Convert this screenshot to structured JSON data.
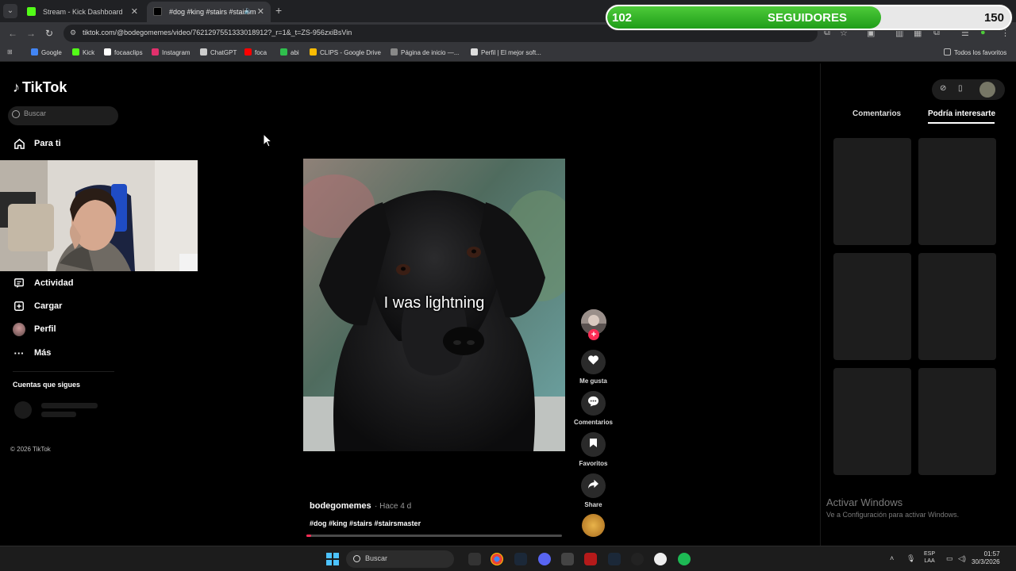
{
  "browser": {
    "tabs": [
      {
        "title": "Stream - Kick Dashboard",
        "favicon_color": "#53fc18"
      },
      {
        "title": "#dog #king #stairs #stairsm",
        "favicon_color": "#ffffff"
      }
    ],
    "url": "tiktok.com/@bodegomemes/video/7621297551333018912?_r=1&_t=ZS-956zxiBsVin",
    "bookmarks": [
      {
        "label": "Google",
        "icon": "google-icon",
        "color": "#4285f4"
      },
      {
        "label": "Kick",
        "icon": "kick-icon",
        "color": "#53fc18"
      },
      {
        "label": "focaaclips",
        "icon": "tiktok-icon",
        "color": "#ffffff"
      },
      {
        "label": "Instagram",
        "icon": "instagram-icon",
        "color": "#e1306c"
      },
      {
        "label": "ChatGPT",
        "icon": "chatgpt-icon",
        "color": "#cccccc"
      },
      {
        "label": "foca",
        "icon": "youtube-icon",
        "color": "#ff0000"
      },
      {
        "label": "abi",
        "icon": "abi-icon",
        "color": "#2fbf4d"
      },
      {
        "label": "CLIPS - Google Drive",
        "icon": "drive-icon",
        "color": "#fbbc04"
      },
      {
        "label": "Página de inicio —...",
        "icon": "page-icon",
        "color": "#888888"
      },
      {
        "label": "Perfil | El mejor soft...",
        "icon": "tag-icon",
        "color": "#dddddd"
      }
    ],
    "all_bookmarks": "Todos los favoritos"
  },
  "follower_goal": {
    "current": "102",
    "label": "SEGUIDORES",
    "goal": "150",
    "progress": 0.68
  },
  "tiktok": {
    "logo": "TikTok",
    "search_placeholder": "Buscar",
    "nav": {
      "for_you": "Para ti",
      "activity": "Actividad",
      "upload": "Cargar",
      "profile": "Perfil",
      "more": "Más"
    },
    "following_title": "Cuentas que sigues",
    "copyright": "© 2026 TikTok",
    "video": {
      "caption": "I was lightning",
      "author": "bodegomemes",
      "posted": "· Hace 4 d",
      "hashtags": "#dog #king #stairs #stairsmaster",
      "progress": 0.02
    },
    "actions": {
      "like": "Me gusta",
      "comments": "Comentarios",
      "favorites": "Favoritos",
      "share": "Share"
    },
    "panel": {
      "tab_comments": "Comentarios",
      "tab_suggested": "Podría interesarte"
    }
  },
  "windows": {
    "activate_title": "Activar Windows",
    "activate_sub": "Ve a Configuración para activar Windows.",
    "taskbar_search": "Buscar",
    "lang_1": "ESP",
    "lang_2": "LAA",
    "time": "01:57",
    "date": "30/3/2026"
  },
  "colors": {
    "accent": "#fe2c55",
    "follower_green": "#1f9d19",
    "windows_blue": "#4cc2ff"
  }
}
